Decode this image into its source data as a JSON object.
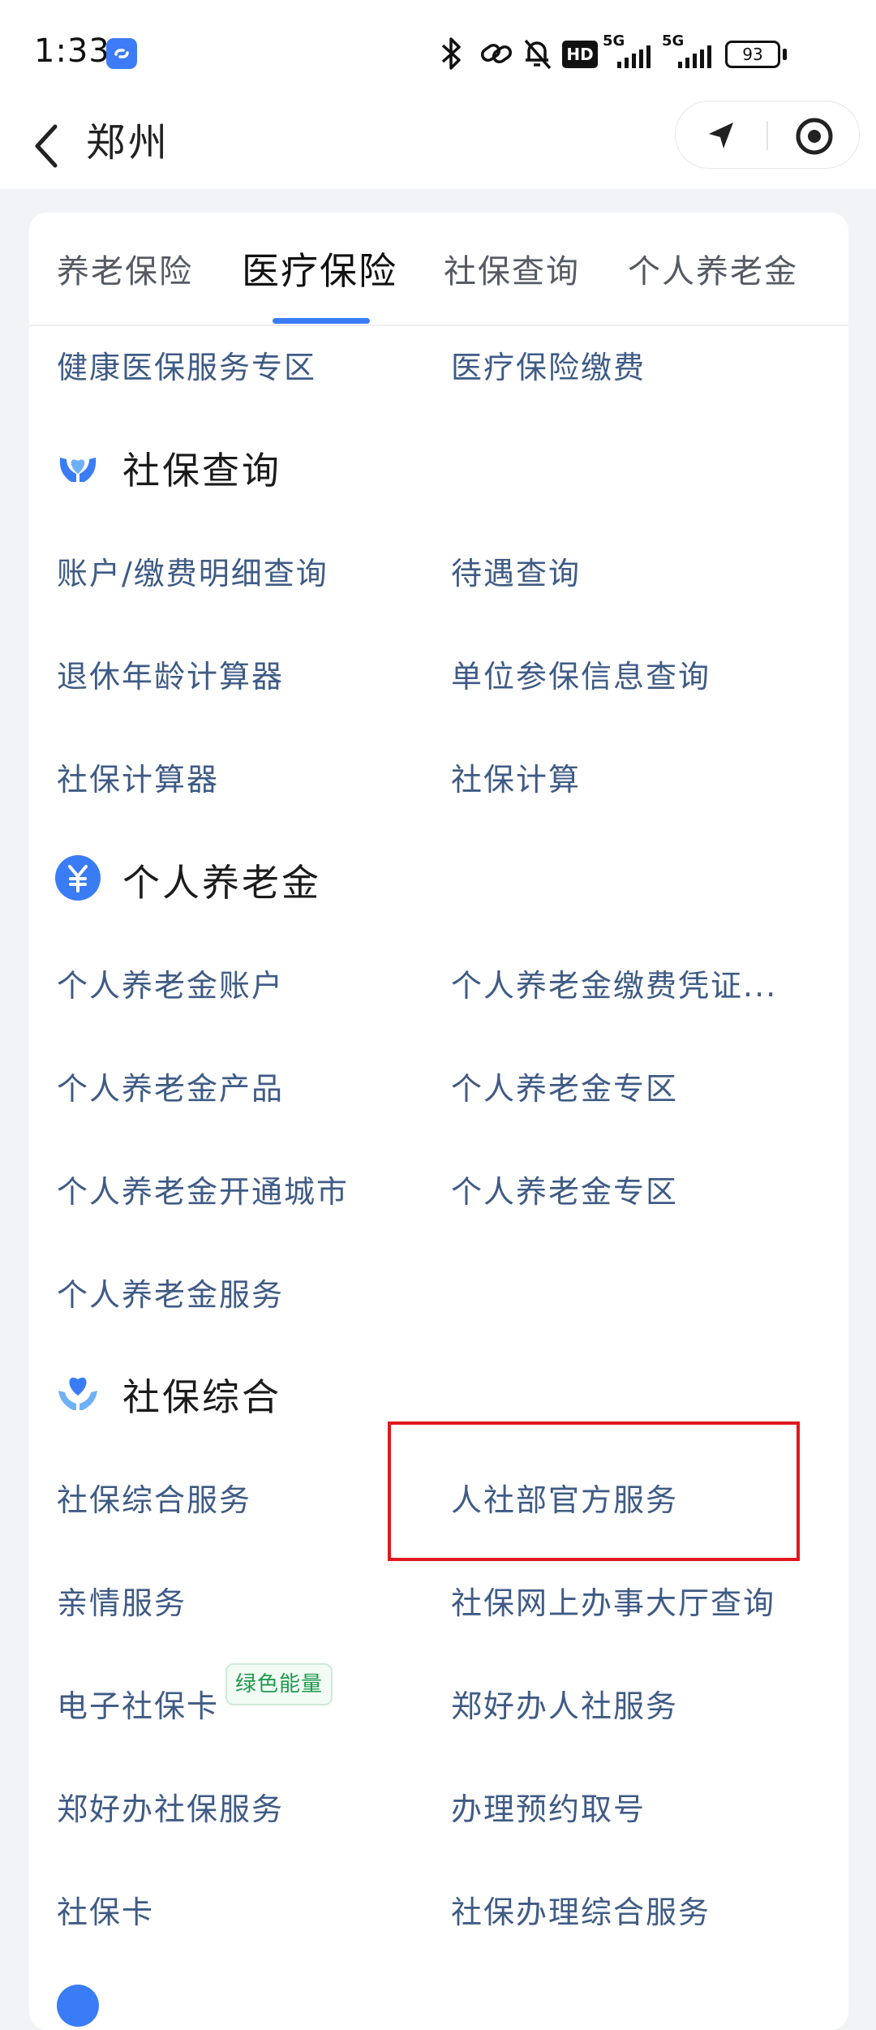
{
  "status_bar": {
    "time": "1:33",
    "battery": "93",
    "network_hd": "HD",
    "network_5g_1": "5G",
    "network_5g_2": "5G"
  },
  "nav": {
    "title": "郑州"
  },
  "tabs": [
    "养老保险",
    "医疗保险",
    "社保查询",
    "个人养老金"
  ],
  "active_tab": "医疗保险",
  "partial_section": {
    "items": [
      "健康医保服务专区",
      "医疗保险缴费"
    ]
  },
  "sections": {
    "query": {
      "title": "社保查询",
      "items": [
        "账户/缴费明细查询",
        "待遇查询",
        "退休年龄计算器",
        "单位参保信息查询",
        "社保计算器",
        "社保计算"
      ]
    },
    "pension": {
      "title": "个人养老金",
      "items": [
        "个人养老金账户",
        "个人养老金缴费凭证...",
        "个人养老金产品",
        "个人养老金专区",
        "个人养老金开通城市",
        "个人养老金专区",
        "个人养老金服务"
      ]
    },
    "general": {
      "title": "社保综合",
      "items": [
        "社保综合服务",
        "人社部官方服务",
        "亲情服务",
        "社保网上办事大厅查询",
        "电子社保卡",
        "郑好办人社服务",
        "郑好办社保服务",
        "办理预约取号",
        "社保卡",
        "社保办理综合服务"
      ],
      "badge": "绿色能量"
    }
  },
  "colors": {
    "accent": "#3a7cf5",
    "item_text": "#3f5b85",
    "highlight": "#e0181e",
    "badge_green": "#1f9a4d"
  }
}
